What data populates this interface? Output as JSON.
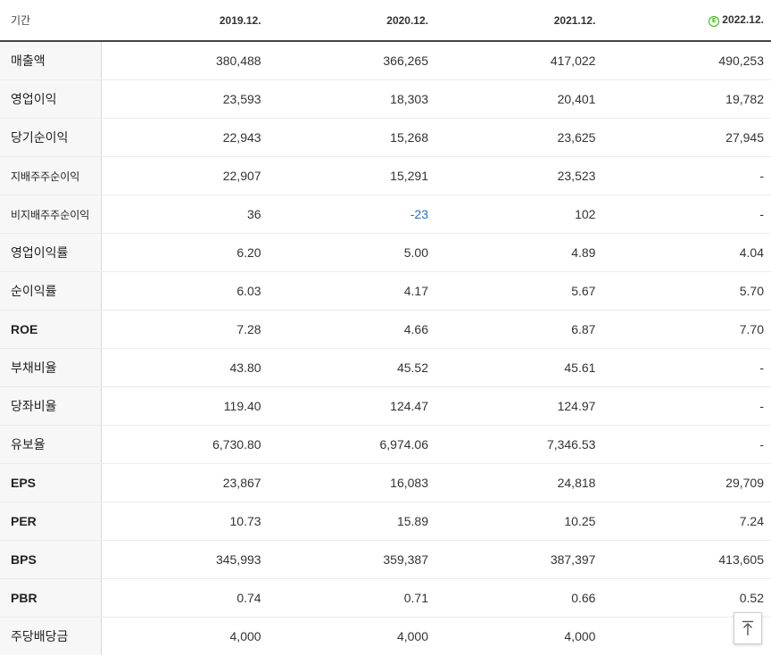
{
  "header": {
    "label": "기간",
    "periods": [
      "2019.12.",
      "2020.12.",
      "2021.12.",
      "2022.12."
    ],
    "estimate_icon_letter": "E",
    "estimate_color": "#2db400"
  },
  "rows": [
    {
      "label": "매출액",
      "values": [
        "380,488",
        "366,265",
        "417,022",
        "490,253"
      ]
    },
    {
      "label": "영업이익",
      "values": [
        "23,593",
        "18,303",
        "20,401",
        "19,782"
      ]
    },
    {
      "label": "당기순이익",
      "values": [
        "22,943",
        "15,268",
        "23,625",
        "27,945"
      ]
    },
    {
      "label": "지배주주순이익",
      "values": [
        "22,907",
        "15,291",
        "23,523",
        "-"
      ]
    },
    {
      "label": "비지배주주순이익",
      "values": [
        "36",
        "-23",
        "102",
        "-"
      ]
    },
    {
      "label": "영업이익률",
      "values": [
        "6.20",
        "5.00",
        "4.89",
        "4.04"
      ]
    },
    {
      "label": "순이익률",
      "values": [
        "6.03",
        "4.17",
        "5.67",
        "5.70"
      ]
    },
    {
      "label": "ROE",
      "values": [
        "7.28",
        "4.66",
        "6.87",
        "7.70"
      ]
    },
    {
      "label": "부채비율",
      "values": [
        "43.80",
        "45.52",
        "45.61",
        "-"
      ]
    },
    {
      "label": "당좌비율",
      "values": [
        "119.40",
        "124.47",
        "124.97",
        "-"
      ]
    },
    {
      "label": "유보율",
      "values": [
        "6,730.80",
        "6,974.06",
        "7,346.53",
        "-"
      ]
    },
    {
      "label": "EPS",
      "values": [
        "23,867",
        "16,083",
        "24,818",
        "29,709"
      ]
    },
    {
      "label": "PER",
      "values": [
        "10.73",
        "15.89",
        "10.25",
        "7.24"
      ]
    },
    {
      "label": "BPS",
      "values": [
        "345,993",
        "359,387",
        "387,397",
        "413,605"
      ]
    },
    {
      "label": "PBR",
      "values": [
        "0.74",
        "0.71",
        "0.66",
        "0.52"
      ]
    },
    {
      "label": "주당배당금",
      "values": [
        "4,000",
        "4,000",
        "4,000",
        ""
      ]
    }
  ],
  "colors": {
    "negative": "#1f6fd1"
  },
  "scroll_top_icon": "arrow-up-to-top-icon"
}
